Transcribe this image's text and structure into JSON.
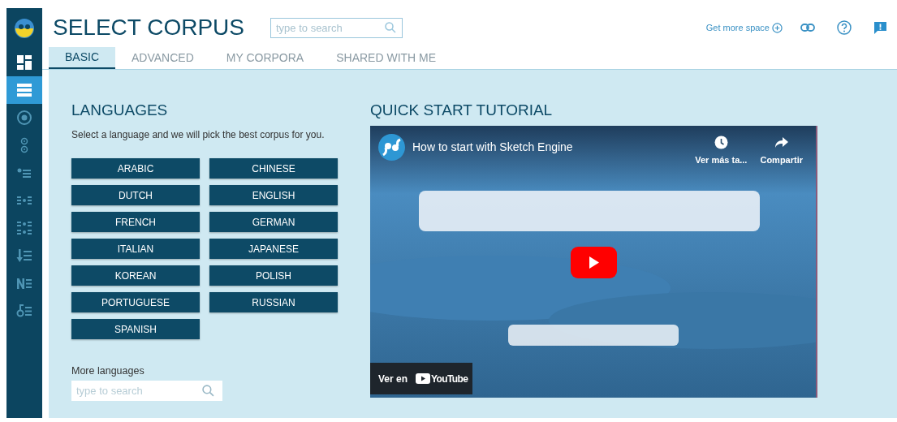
{
  "app": {
    "title": "SELECT CORPUS",
    "search": {
      "placeholder": "type to search"
    },
    "get_more_space": "Get more space"
  },
  "sidebar": {
    "items": [
      {
        "kind": "grid",
        "selected": false
      },
      {
        "kind": "list",
        "selected": true
      },
      {
        "kind": "ring",
        "selected": false
      },
      {
        "kind": "rings",
        "selected": false
      },
      {
        "kind": "dot-list",
        "selected": false
      },
      {
        "kind": "dot-grid",
        "selected": false
      },
      {
        "kind": "dot-grid-double",
        "selected": false
      },
      {
        "kind": "arrow-list",
        "selected": false
      },
      {
        "kind": "n-list",
        "selected": false
      },
      {
        "kind": "key-list",
        "selected": false
      }
    ]
  },
  "tabs": [
    {
      "label": "BASIC",
      "selected": true
    },
    {
      "label": "ADVANCED",
      "selected": false
    },
    {
      "label": "MY CORPORA",
      "selected": false
    },
    {
      "label": "SHARED WITH ME",
      "selected": false
    }
  ],
  "languages": {
    "title": "LANGUAGES",
    "hint": "Select a language and we will pick the best corpus for you.",
    "buttons": [
      "ARABIC",
      "CHINESE",
      "DUTCH",
      "ENGLISH",
      "FRENCH",
      "GERMAN",
      "ITALIAN",
      "JAPANESE",
      "KOREAN",
      "POLISH",
      "PORTUGUESE",
      "RUSSIAN",
      "SPANISH"
    ],
    "more_label": "More languages",
    "more_search": {
      "placeholder": "type to search"
    }
  },
  "tutorial": {
    "title": "QUICK START TUTORIAL",
    "video": {
      "kind": "picture",
      "title": "How to start with Sketch Engine",
      "watch_later": "Ver más ta...",
      "share": "Compartir",
      "watch_on": "Ver en",
      "brand": "YouTube"
    }
  }
}
